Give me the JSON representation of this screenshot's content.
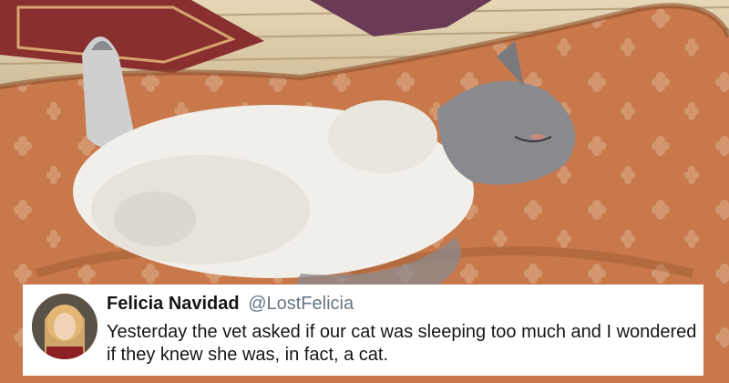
{
  "tweet": {
    "display_name": "Felicia Navidad",
    "handle": "@LostFelicia",
    "text": "Yesterday the vet asked if our cat was sleeping too much and I wondered if they knew she was, in fact, a cat."
  },
  "photo": {
    "subject": "cat-icon",
    "colors": {
      "cushion": "#c8784a",
      "cushion_shadow": "#8e4f2c",
      "floor": "#d8c7a6",
      "rug": "#8a2f2f",
      "cat_white": "#f1efe9",
      "cat_gray": "#8a8a8e"
    }
  }
}
